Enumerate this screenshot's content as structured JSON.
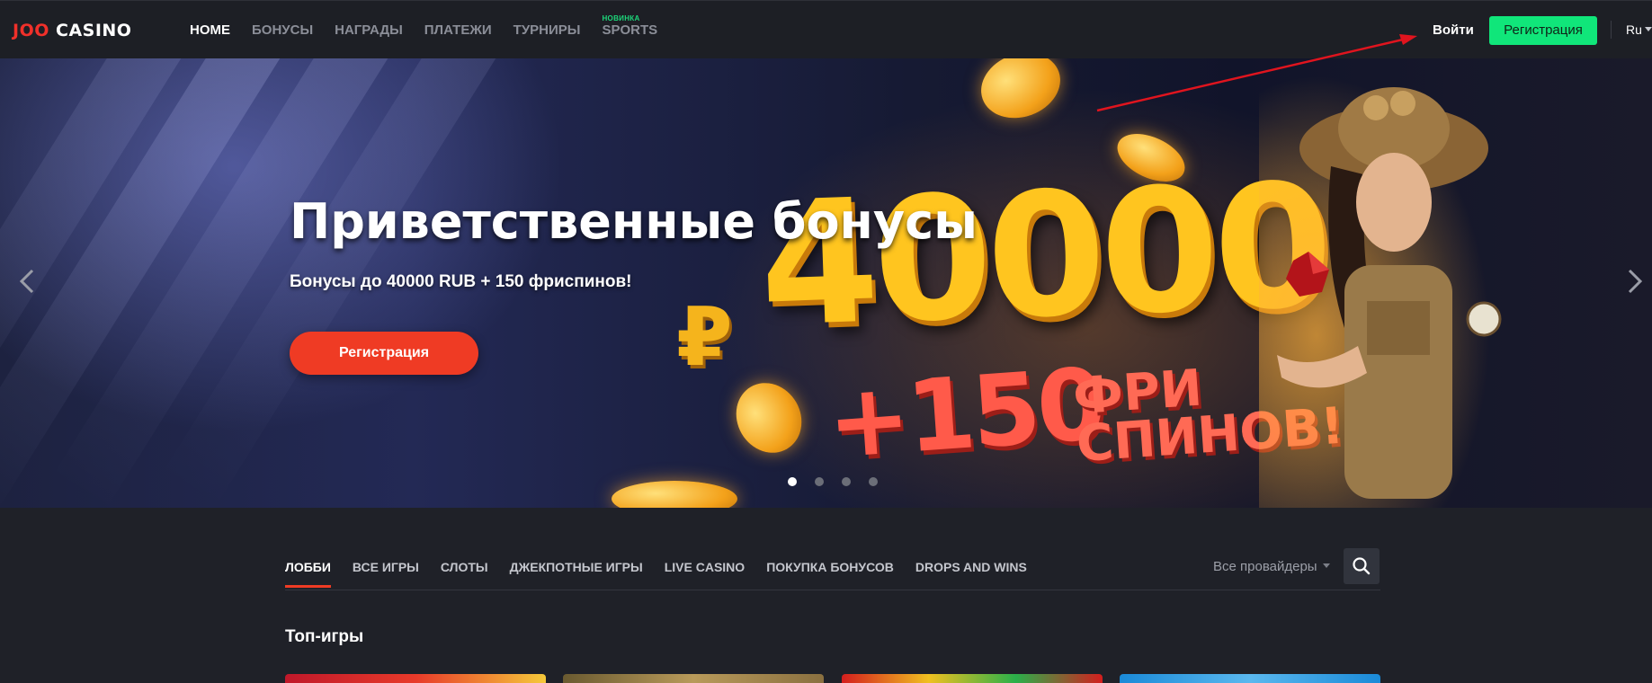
{
  "header": {
    "logo_part1": "JOO",
    "logo_part2": "CASINO",
    "nav": [
      {
        "label": "HOME",
        "active": true
      },
      {
        "label": "БОНУСЫ"
      },
      {
        "label": "НАГРАДЫ"
      },
      {
        "label": "ПЛАТЕЖИ"
      },
      {
        "label": "ТУРНИРЫ"
      },
      {
        "label": "SPORTS",
        "badge": "НОВИНКА"
      }
    ],
    "login_label": "Войти",
    "register_label": "Регистрация",
    "language": "Ru"
  },
  "banner": {
    "title": "Приветственные бонусы",
    "subtitle": "Бонусы до 40000 RUB + 150 фриспинов!",
    "button_label": "Регистрация",
    "promo_currency": "₽",
    "promo_amount": "40000",
    "promo_spins_count": "+150",
    "promo_spins_line1": "ФРИ",
    "promo_spins_line2": "СПИНОВ!",
    "slide_count": 4,
    "active_slide": 1
  },
  "lobby": {
    "categories": [
      {
        "label": "ЛОББИ",
        "active": true
      },
      {
        "label": "ВСЕ ИГРЫ"
      },
      {
        "label": "СЛОТЫ"
      },
      {
        "label": "ДЖЕКПОТНЫЕ ИГРЫ"
      },
      {
        "label": "LIVE CASINO"
      },
      {
        "label": "ПОКУПКА БОНУСОВ"
      },
      {
        "label": "DROPS AND WINS"
      }
    ],
    "providers_label": "Все провайдеры",
    "section_title": "Топ-игры"
  },
  "colors": {
    "accent_red": "#ef3b24",
    "accent_green": "#10e67a",
    "background": "#1f2128"
  },
  "icons": [
    "chevron-left-icon",
    "chevron-right-icon",
    "search-icon",
    "caret-down-icon"
  ]
}
